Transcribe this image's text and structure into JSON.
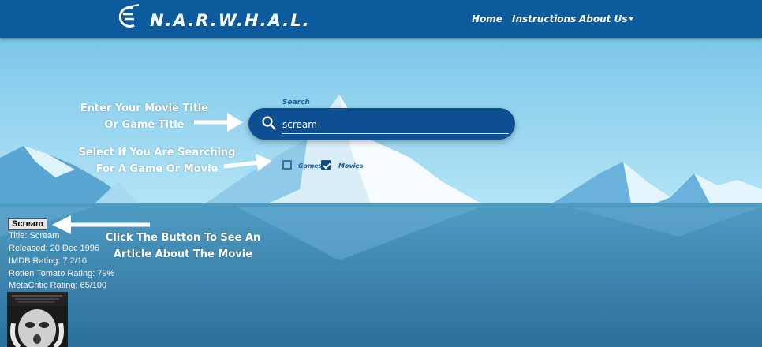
{
  "header": {
    "brand": "N.A.R.W.H.A.L.",
    "nav": [
      "Home",
      "Instructions",
      "About Us"
    ]
  },
  "search": {
    "label": "Search",
    "value": "scream",
    "placeholder": ""
  },
  "filters": {
    "games_label": "Games",
    "games_checked": false,
    "movies_label": "Movies",
    "movies_checked": true
  },
  "annotations": {
    "title_hint": [
      "Enter Your Movie Title",
      "Or Game Title"
    ],
    "filter_hint": [
      "Select If You Are Searching",
      "For A Game Or Movie"
    ],
    "button_hint": [
      "Click The Button To See An",
      "Article About The Movie"
    ]
  },
  "result": {
    "button_label": "Scream",
    "lines": [
      "Title: Scream",
      "Released: 20 Dec 1996",
      "IMDB Rating: 7.2/10",
      "Rotten Tomato Rating: 79%",
      "MetaCritic Rating: 65/100"
    ]
  },
  "colors": {
    "header": "#0d5a9c",
    "search_bar": "#0d4f91",
    "sky": "#7cc8ea",
    "sea": "#3d8ab2"
  },
  "icons": [
    "narwhal-logo-icon",
    "search-icon",
    "dropdown-caret-icon",
    "arrow-right-icon",
    "arrow-left-icon"
  ]
}
